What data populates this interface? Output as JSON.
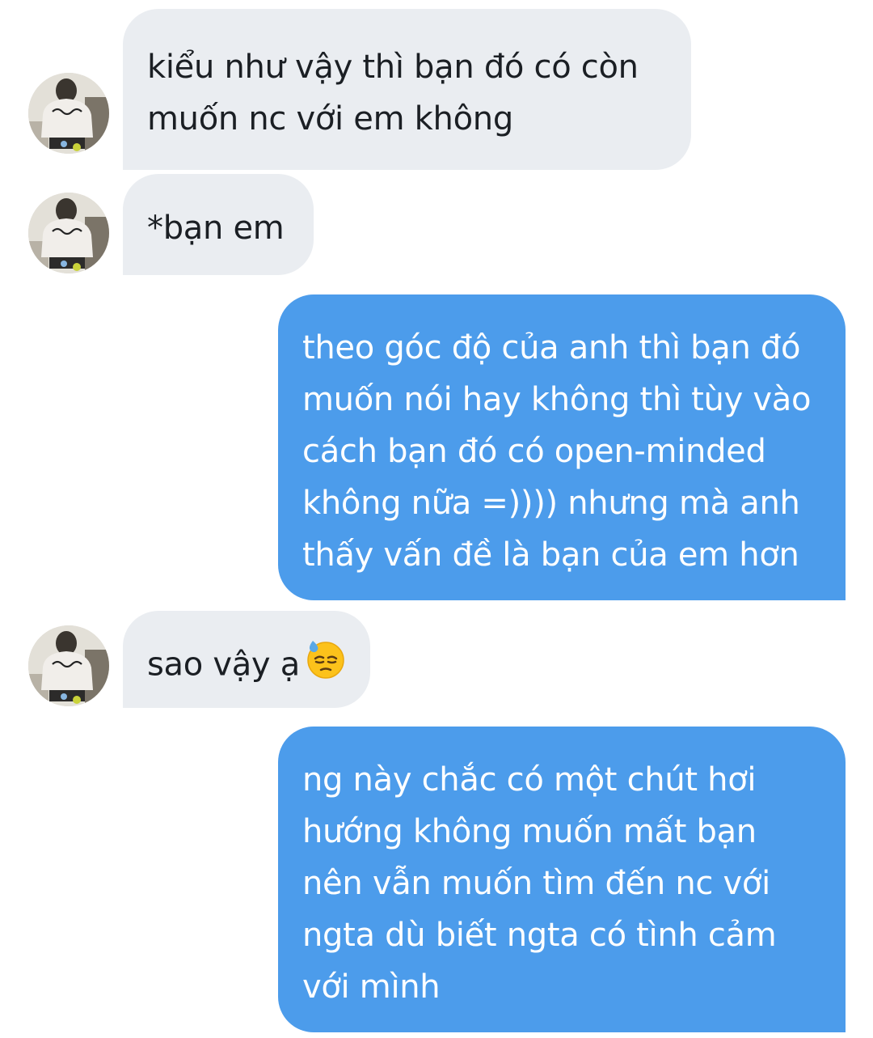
{
  "conversation": {
    "messages": [
      {
        "direction": "incoming",
        "lines": [
          "kiểu như vậy thì bạn đó có còn",
          "muốn nc với em không"
        ]
      },
      {
        "direction": "incoming",
        "lines": [
          "*bạn em"
        ]
      },
      {
        "direction": "outgoing",
        "lines": [
          "theo góc độ của anh thì bạn đó",
          "muốn nói hay không thì tùy vào",
          "cách bạn đó có open-minded",
          "không nữa =)))) nhưng mà anh",
          "thấy vấn đề là bạn của em hơn"
        ]
      },
      {
        "direction": "incoming",
        "lines": [
          "sao vậy ạ"
        ],
        "emoji": "downcast-face-with-sweat-icon"
      },
      {
        "direction": "outgoing",
        "lines": [
          "ng này chắc có một chút hơi",
          "hướng không muốn mất bạn",
          "nên vẫn muốn tìm đến nc với",
          "ngta dù biết ngta có tình cảm",
          "với mình"
        ]
      }
    ]
  },
  "colors": {
    "incoming_bubble": "#eaedf1",
    "outgoing_bubble": "#4c9ceb",
    "incoming_text": "#1b1f24",
    "outgoing_text": "#ffffff"
  }
}
